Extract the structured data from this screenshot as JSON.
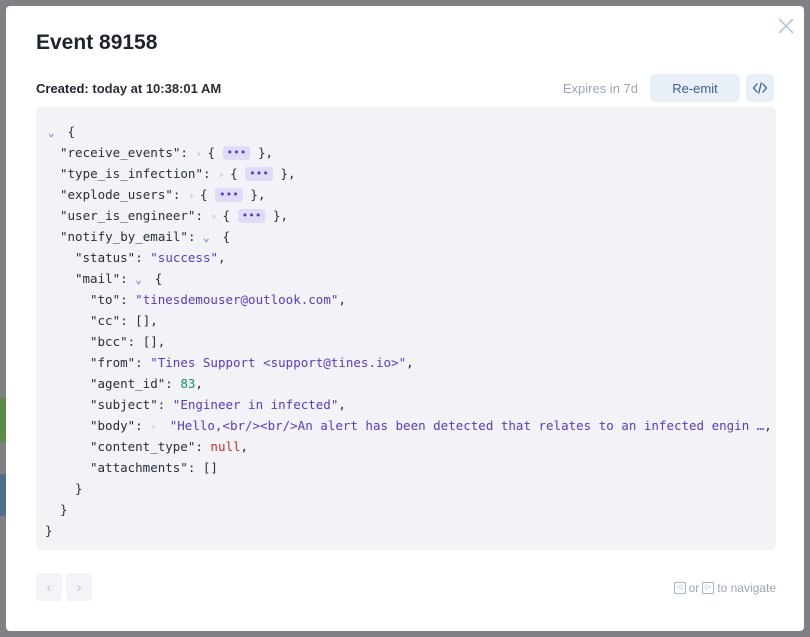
{
  "event": {
    "title": "Event 89158",
    "created_label": "Created:",
    "created_value": "today at 10:38:01 AM",
    "expires": "Expires in 7d",
    "reemit_label": "Re-emit",
    "code_icon": "code-icon"
  },
  "json": {
    "open_brace": "{",
    "close_brace": "}",
    "receive_events_key": "\"receive_events\"",
    "type_is_infection_key": "\"type_is_infection\"",
    "explode_users_key": "\"explode_users\"",
    "user_is_engineer_key": "\"user_is_engineer\"",
    "notify_by_email_key": "\"notify_by_email\"",
    "status_key": "\"status\"",
    "status_val": "\"success\"",
    "mail_key": "\"mail\"",
    "to_key": "\"to\"",
    "to_val": "\"tinesdemouser@outlook.com\"",
    "cc_key": "\"cc\"",
    "cc_val": "[]",
    "bcc_key": "\"bcc\"",
    "bcc_val": "[]",
    "from_key": "\"from\"",
    "from_val": "\"Tines Support <support@tines.io>\"",
    "agent_id_key": "\"agent_id\"",
    "agent_id_val": "83",
    "subject_key": "\"subject\"",
    "subject_val": "\"Engineer in infected\"",
    "body_key": "\"body\"",
    "body_val": "\"Hello,<br/><br/>An alert has been detected that relates to an infected engin …",
    "content_type_key": "\"content_type\"",
    "content_type_val": "null",
    "attachments_key": "\"attachments\"",
    "attachments_val": "[]",
    "ellipsis": "•••"
  },
  "footer": {
    "hint_or": "or",
    "hint_navigate": "to navigate"
  }
}
